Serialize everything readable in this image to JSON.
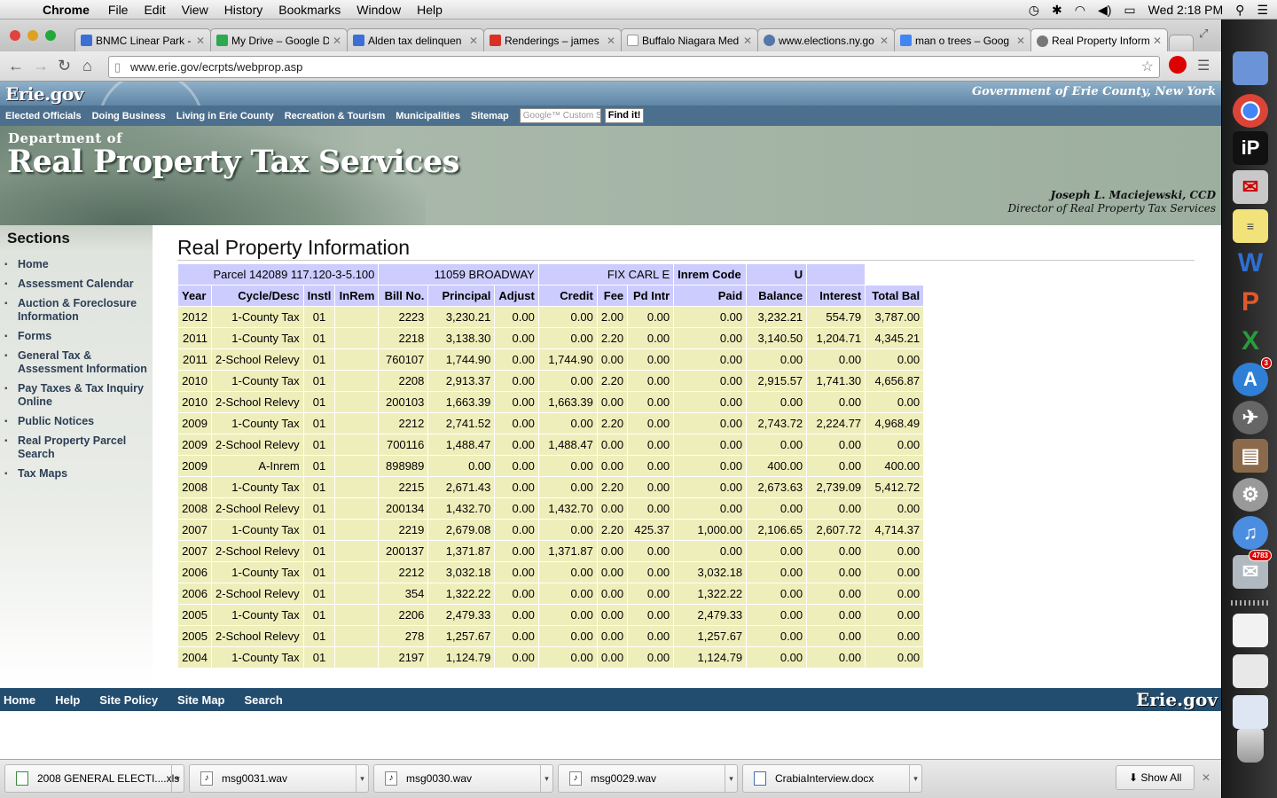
{
  "menubar": {
    "app": "Chrome",
    "items": [
      "File",
      "Edit",
      "View",
      "History",
      "Bookmarks",
      "Window",
      "Help"
    ],
    "clock": "Wed 2:18 PM"
  },
  "tabs": [
    {
      "title": "BNMC Linear Park -",
      "color": "#3b6fd6"
    },
    {
      "title": "My Drive – Google D",
      "color": "#2da94f"
    },
    {
      "title": "Alden tax delinquen",
      "color": "#3b6fd6"
    },
    {
      "title": "Renderings – james",
      "color": "#d93025"
    },
    {
      "title": "Buffalo Niagara Med",
      "color": "#bbbbbb"
    },
    {
      "title": "www.elections.ny.go",
      "color": "#5577aa"
    },
    {
      "title": "man o trees – Goog",
      "color": "#4285f4"
    },
    {
      "title": "Real Property Inform",
      "color": "#777777"
    }
  ],
  "url": "www.erie.gov/ecrpts/webprop.asp",
  "site": {
    "logo": "Erie.gov",
    "government": "Government of Erie County, New York",
    "topnav": [
      "Elected Officials",
      "Doing Business",
      "Living in Erie County",
      "Recreation & Tourism",
      "Municipalities",
      "Sitemap"
    ],
    "search_placeholder": "Google™ Custom Search",
    "find_button": "Find it!",
    "dept_small": "Department of",
    "dept_big": "Real Property Tax Services",
    "director_name": "Joseph L. Maciejewski, CCD",
    "director_title": "Director of Real Property Tax Services"
  },
  "sidebar": {
    "title": "Sections",
    "items": [
      "Home",
      "Assessment Calendar",
      "Auction & Foreclosure Information",
      "Forms",
      "General Tax & Assessment Information",
      "Pay Taxes & Tax Inquiry Online",
      "Public Notices",
      "Real Property Parcel Search",
      "Tax Maps"
    ]
  },
  "main": {
    "title": "Real Property Information",
    "parcel": "Parcel 142089 117.120-3-5.100",
    "address": "11059 BROADWAY",
    "owner": "FIX CARL E",
    "inrem_label": "Inrem Code",
    "inrem_value": "U",
    "columns": [
      "Year",
      "Cycle/Desc",
      "Instl",
      "InRem",
      "Bill No.",
      "Principal",
      "Adjust",
      "Credit",
      "Fee",
      "Pd Intr",
      "Paid",
      "Balance",
      "Interest",
      "Total Bal"
    ],
    "rows": [
      [
        "2012",
        "1-County Tax",
        "01",
        "",
        "2223",
        "3,230.21",
        "0.00",
        "0.00",
        "2.00",
        "0.00",
        "0.00",
        "3,232.21",
        "554.79",
        "3,787.00"
      ],
      [
        "2011",
        "1-County Tax",
        "01",
        "",
        "2218",
        "3,138.30",
        "0.00",
        "0.00",
        "2.20",
        "0.00",
        "0.00",
        "3,140.50",
        "1,204.71",
        "4,345.21"
      ],
      [
        "2011",
        "2-School Relevy",
        "01",
        "",
        "760107",
        "1,744.90",
        "0.00",
        "1,744.90",
        "0.00",
        "0.00",
        "0.00",
        "0.00",
        "0.00",
        "0.00"
      ],
      [
        "2010",
        "1-County Tax",
        "01",
        "",
        "2208",
        "2,913.37",
        "0.00",
        "0.00",
        "2.20",
        "0.00",
        "0.00",
        "2,915.57",
        "1,741.30",
        "4,656.87"
      ],
      [
        "2010",
        "2-School Relevy",
        "01",
        "",
        "200103",
        "1,663.39",
        "0.00",
        "1,663.39",
        "0.00",
        "0.00",
        "0.00",
        "0.00",
        "0.00",
        "0.00"
      ],
      [
        "2009",
        "1-County Tax",
        "01",
        "",
        "2212",
        "2,741.52",
        "0.00",
        "0.00",
        "2.20",
        "0.00",
        "0.00",
        "2,743.72",
        "2,224.77",
        "4,968.49"
      ],
      [
        "2009",
        "2-School Relevy",
        "01",
        "",
        "700116",
        "1,488.47",
        "0.00",
        "1,488.47",
        "0.00",
        "0.00",
        "0.00",
        "0.00",
        "0.00",
        "0.00"
      ],
      [
        "2009",
        "A-Inrem",
        "01",
        "",
        "898989",
        "0.00",
        "0.00",
        "0.00",
        "0.00",
        "0.00",
        "0.00",
        "400.00",
        "0.00",
        "400.00"
      ],
      [
        "2008",
        "1-County Tax",
        "01",
        "",
        "2215",
        "2,671.43",
        "0.00",
        "0.00",
        "2.20",
        "0.00",
        "0.00",
        "2,673.63",
        "2,739.09",
        "5,412.72"
      ],
      [
        "2008",
        "2-School Relevy",
        "01",
        "",
        "200134",
        "1,432.70",
        "0.00",
        "1,432.70",
        "0.00",
        "0.00",
        "0.00",
        "0.00",
        "0.00",
        "0.00"
      ],
      [
        "2007",
        "1-County Tax",
        "01",
        "",
        "2219",
        "2,679.08",
        "0.00",
        "0.00",
        "2.20",
        "425.37",
        "1,000.00",
        "2,106.65",
        "2,607.72",
        "4,714.37"
      ],
      [
        "2007",
        "2-School Relevy",
        "01",
        "",
        "200137",
        "1,371.87",
        "0.00",
        "1,371.87",
        "0.00",
        "0.00",
        "0.00",
        "0.00",
        "0.00",
        "0.00"
      ],
      [
        "2006",
        "1-County Tax",
        "01",
        "",
        "2212",
        "3,032.18",
        "0.00",
        "0.00",
        "0.00",
        "0.00",
        "3,032.18",
        "0.00",
        "0.00",
        "0.00"
      ],
      [
        "2006",
        "2-School Relevy",
        "01",
        "",
        "354",
        "1,322.22",
        "0.00",
        "0.00",
        "0.00",
        "0.00",
        "1,322.22",
        "0.00",
        "0.00",
        "0.00"
      ],
      [
        "2005",
        "1-County Tax",
        "01",
        "",
        "2206",
        "2,479.33",
        "0.00",
        "0.00",
        "0.00",
        "0.00",
        "2,479.33",
        "0.00",
        "0.00",
        "0.00"
      ],
      [
        "2005",
        "2-School Relevy",
        "01",
        "",
        "278",
        "1,257.67",
        "0.00",
        "0.00",
        "0.00",
        "0.00",
        "1,257.67",
        "0.00",
        "0.00",
        "0.00"
      ],
      [
        "2004",
        "1-County Tax",
        "01",
        "",
        "2197",
        "1,124.79",
        "0.00",
        "0.00",
        "0.00",
        "0.00",
        "1,124.79",
        "0.00",
        "0.00",
        "0.00"
      ]
    ]
  },
  "footer": {
    "links": [
      "Home",
      "Help",
      "Site Policy",
      "Site Map",
      "Search"
    ],
    "logo": "Erie.gov"
  },
  "downloads": {
    "files": [
      "2008 GENERAL ELECTI....xls",
      "msg0031.wav",
      "msg0030.wav",
      "msg0029.wav",
      "CrabiaInterview.docx"
    ],
    "show_all": "Show All"
  },
  "dock": {
    "badge_appstore": "3",
    "badge_mail": "4783"
  }
}
